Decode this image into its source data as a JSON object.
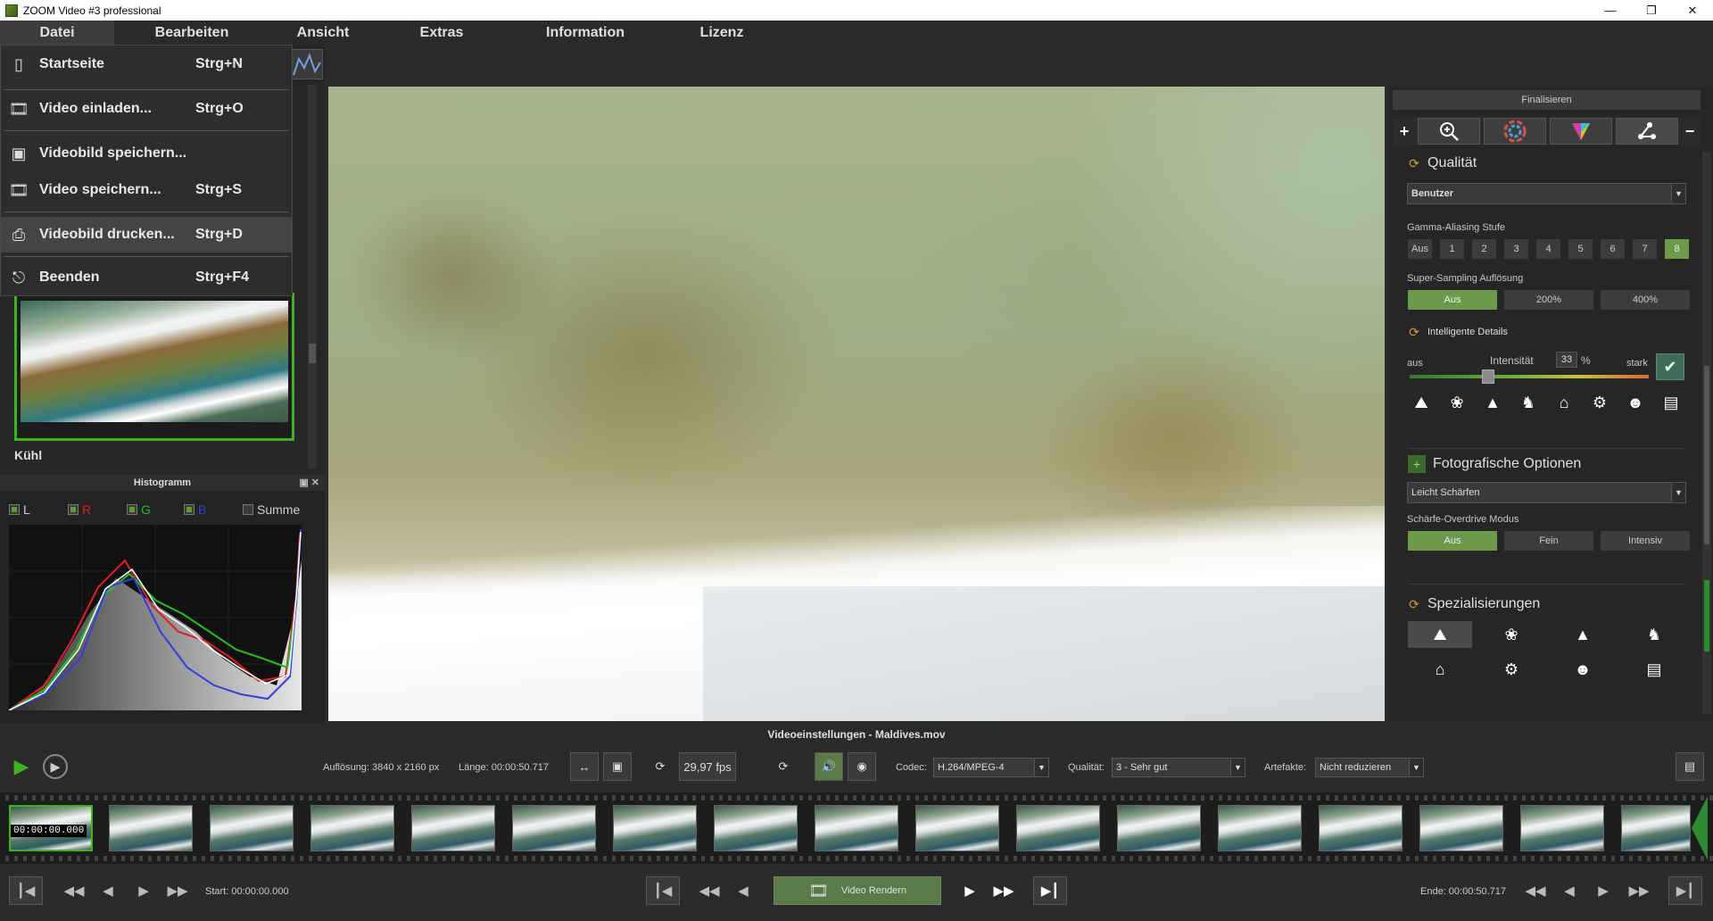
{
  "window": {
    "title": "ZOOM Video #3 professional"
  },
  "menu": [
    {
      "label": "Datei"
    },
    {
      "label": "Bearbeiten"
    },
    {
      "label": "Ansicht"
    },
    {
      "label": "Extras"
    },
    {
      "label": "Information"
    },
    {
      "label": "Lizenz"
    }
  ],
  "file_menu": {
    "items": [
      {
        "label": "Startseite",
        "shortcut": "Strg+N",
        "icon": "page-icon"
      },
      {
        "label": "Video einladen...",
        "shortcut": "Strg+O",
        "icon": "film-open-icon"
      },
      {
        "label": "Videobild speichern...",
        "shortcut": "",
        "icon": "floppy-icon"
      },
      {
        "label": "Video speichern...",
        "shortcut": "Strg+S",
        "icon": "film-save-icon"
      },
      {
        "label": "Videobild drucken...",
        "shortcut": "Strg+D",
        "icon": "printer-icon"
      },
      {
        "label": "Beenden",
        "shortcut": "Strg+F4",
        "icon": "power-icon"
      }
    ]
  },
  "left": {
    "preset_label": "Kühl"
  },
  "histogram": {
    "title": "Histogramm",
    "channels": [
      {
        "label": "L",
        "checked": true,
        "color": "#d0d0d0"
      },
      {
        "label": "R",
        "checked": true,
        "color": "#e02020"
      },
      {
        "label": "G",
        "checked": true,
        "color": "#20c020"
      },
      {
        "label": "B",
        "checked": true,
        "color": "#3040e0"
      },
      {
        "label": "Summe",
        "checked": false,
        "color": "#d0d0d0"
      }
    ]
  },
  "right": {
    "finalize": "Finalisieren",
    "quality": {
      "title": "Qualität",
      "preset": "Benutzer",
      "gamma_label": "Gamma-Aliasing Stufe",
      "gamma_levels": [
        "Aus",
        "1",
        "2",
        "3",
        "4",
        "5",
        "6",
        "7",
        "8"
      ],
      "gamma_selected": "8",
      "supersampling_label": "Super-Sampling Auflösung",
      "supersampling": [
        "Aus",
        "200%",
        "400%"
      ],
      "supersampling_selected": "Aus"
    },
    "details": {
      "title": "Intelligente Details",
      "min_label": "aus",
      "max_label": "stark",
      "intensity_label": "Intensität",
      "intensity_value": "33",
      "intensity_unit": "%",
      "intensity": 33
    },
    "photo": {
      "title": "Fotografische Optionen",
      "preset": "Leicht Schärfen",
      "overdrive_label": "Schärfe-Overdrive Modus",
      "overdrive": [
        "Aus",
        "Fein",
        "Intensiv"
      ],
      "overdrive_selected": "Aus"
    },
    "spec": {
      "title": "Spezialisierungen"
    }
  },
  "bottom": {
    "title": "Videoeinstellungen - Maldives.mov",
    "resolution": "Auflösung: 3840 x 2160 px",
    "length": "Länge: 00:00:50.717",
    "fps": "29,97 fps",
    "codec_label": "Codec:",
    "codec": "H.264/MPEG-4",
    "quality_label": "Qualität:",
    "quality": "3 - Sehr gut",
    "artifacts_label": "Artefakte:",
    "artifacts": "Nicht reduzieren",
    "timecode": "00:00:00.000",
    "start": "Start: 00:00:00.000",
    "end": "Ende: 00:00:50.717",
    "render": "Video Rendern"
  }
}
